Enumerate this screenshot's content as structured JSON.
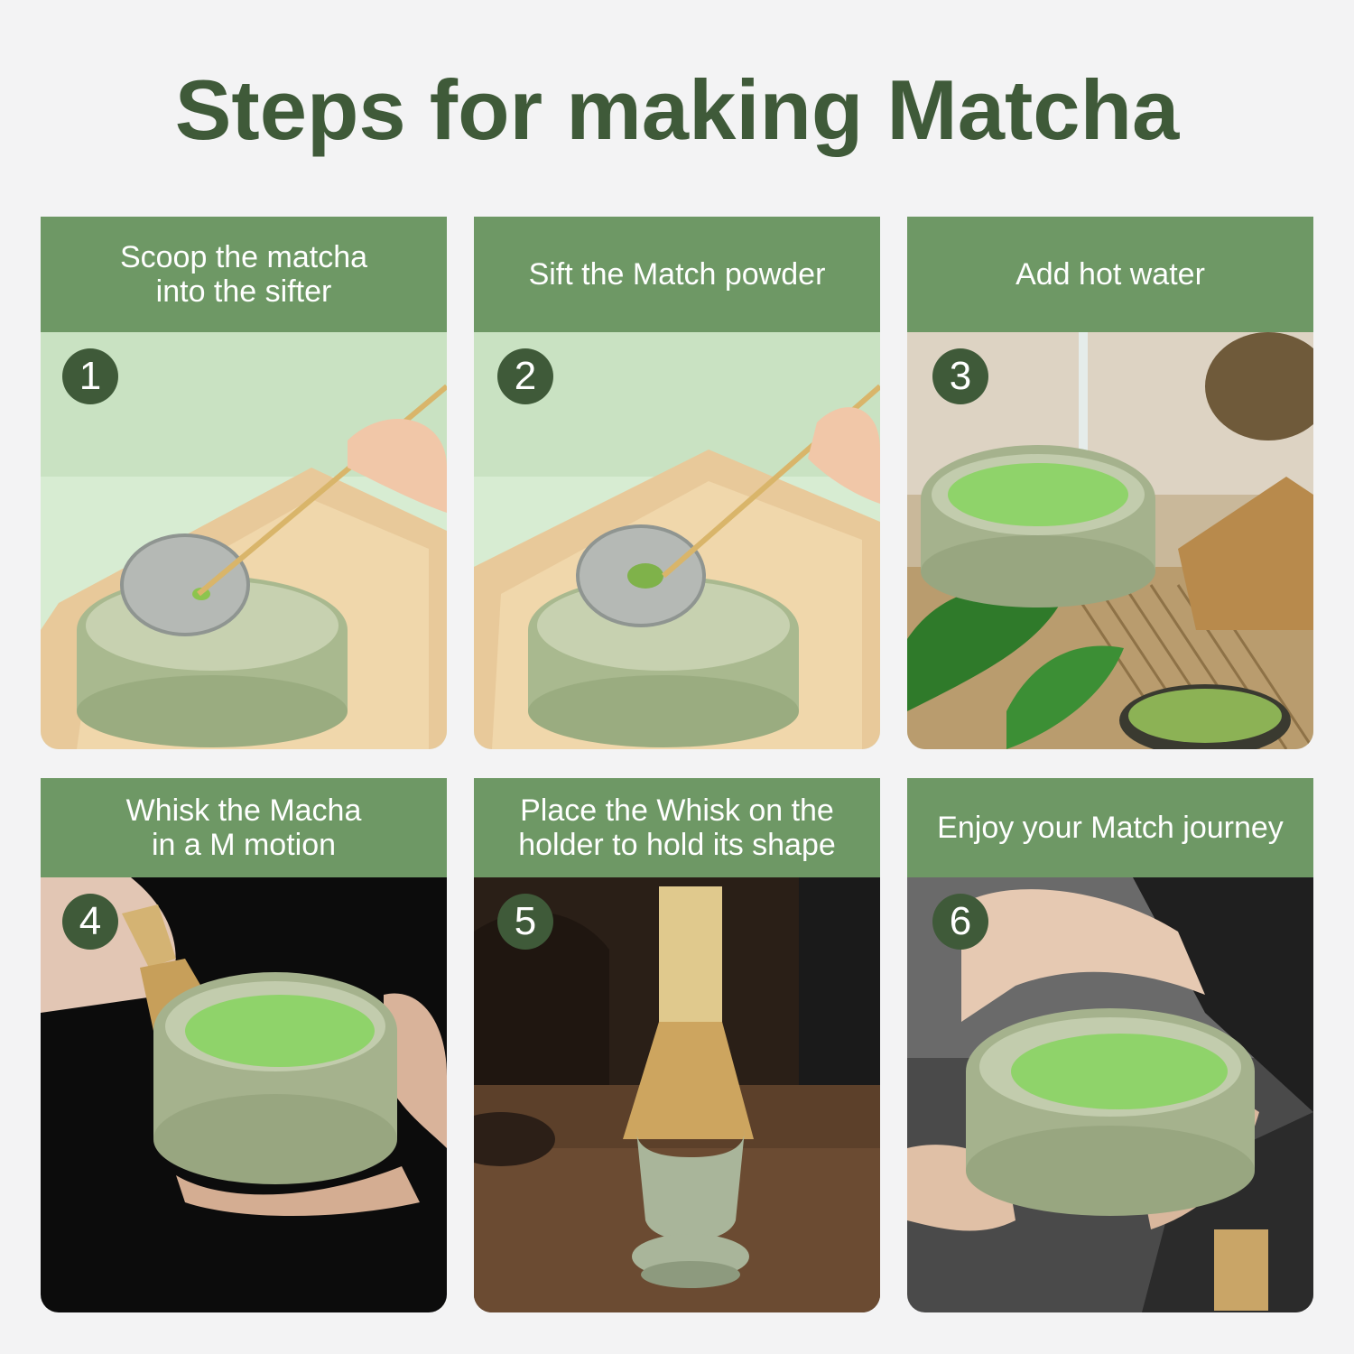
{
  "title": "Steps for making Matcha",
  "steps": [
    {
      "number": "1",
      "text": "Scoop the matcha\ninto the sifter"
    },
    {
      "number": "2",
      "text": "Sift the Match powder"
    },
    {
      "number": "3",
      "text": "Add hot water"
    },
    {
      "number": "4",
      "text": "Whisk the Macha\nin a M motion"
    },
    {
      "number": "5",
      "text": "Place the Whisk on the\nholder to hold its shape"
    },
    {
      "number": "6",
      "text": "Enjoy your Match journey"
    }
  ],
  "colors": {
    "title": "#3f5a39",
    "header_bg": "#6e9865",
    "badge_bg": "#3f5a39",
    "page_bg": "#f3f3f4"
  }
}
